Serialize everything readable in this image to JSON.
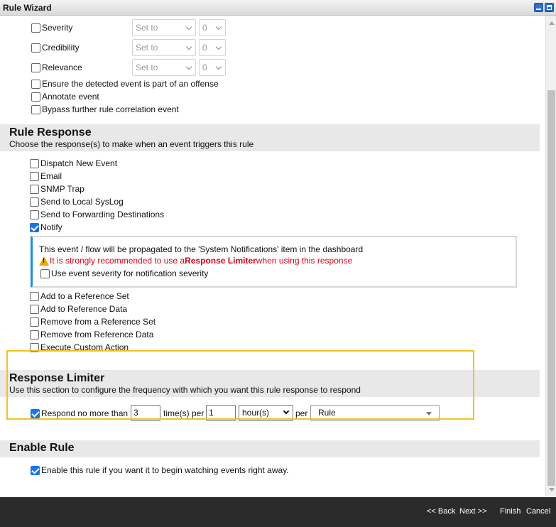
{
  "window": {
    "title": "Rule Wizard"
  },
  "top_options": {
    "severity": {
      "label": "Severity",
      "set_value": "Set to",
      "num_value": "0"
    },
    "credibility": {
      "label": "Credibility",
      "set_value": "Set to",
      "num_value": "0"
    },
    "relevance": {
      "label": "Relevance",
      "set_value": "Set to",
      "num_value": "0"
    },
    "ensure_offense": "Ensure the detected event is part of an offense",
    "annotate": "Annotate event",
    "bypass": "Bypass further rule correlation event"
  },
  "rule_response": {
    "heading": "Rule Response",
    "description": "Choose the response(s) to make when an event triggers this rule",
    "options": [
      {
        "label": "Dispatch New Event",
        "checked": false
      },
      {
        "label": "Email",
        "checked": false
      },
      {
        "label": "SNMP Trap",
        "checked": false
      },
      {
        "label": "Send to Local SysLog",
        "checked": false
      },
      {
        "label": "Send to Forwarding Destinations",
        "checked": false
      },
      {
        "label": "Notify",
        "checked": true
      }
    ],
    "notify_box": {
      "info": "This event / flow will be propagated to the 'System Notifications' item in the dashboard",
      "warning_pre": "It is strongly recommended to use a ",
      "warning_bold": "Response Limiter",
      "warning_post": " when using this response",
      "severity_option": "Use event severity for notification severity"
    },
    "more_options": [
      {
        "label": "Add to a Reference Set",
        "checked": false
      },
      {
        "label": "Add to Reference Data",
        "checked": false
      },
      {
        "label": "Remove from a Reference Set",
        "checked": false
      },
      {
        "label": "Remove from Reference Data",
        "checked": false
      },
      {
        "label": "Execute Custom Action",
        "checked": false
      }
    ]
  },
  "response_limiter": {
    "heading": "Response Limiter",
    "description": "Use this section to configure the frequency with which you want this rule response to respond",
    "respond_label": "Respond no more than",
    "times_value": "3",
    "times_per_label": "time(s) per",
    "period_value": "1",
    "unit_value": "hour(s)",
    "per_label": "per",
    "scope_value": "Rule"
  },
  "enable_rule": {
    "heading": "Enable Rule",
    "label": "Enable this rule if you want it to begin watching events right away."
  },
  "footer": {
    "back": "<< Back",
    "next": "Next >>",
    "finish": "Finish",
    "cancel": "Cancel"
  },
  "colors": {
    "accent": "#1a73e8",
    "warning": "#d9001b",
    "highlight": "#f2c418",
    "footer_bg": "#2b2b2b"
  }
}
